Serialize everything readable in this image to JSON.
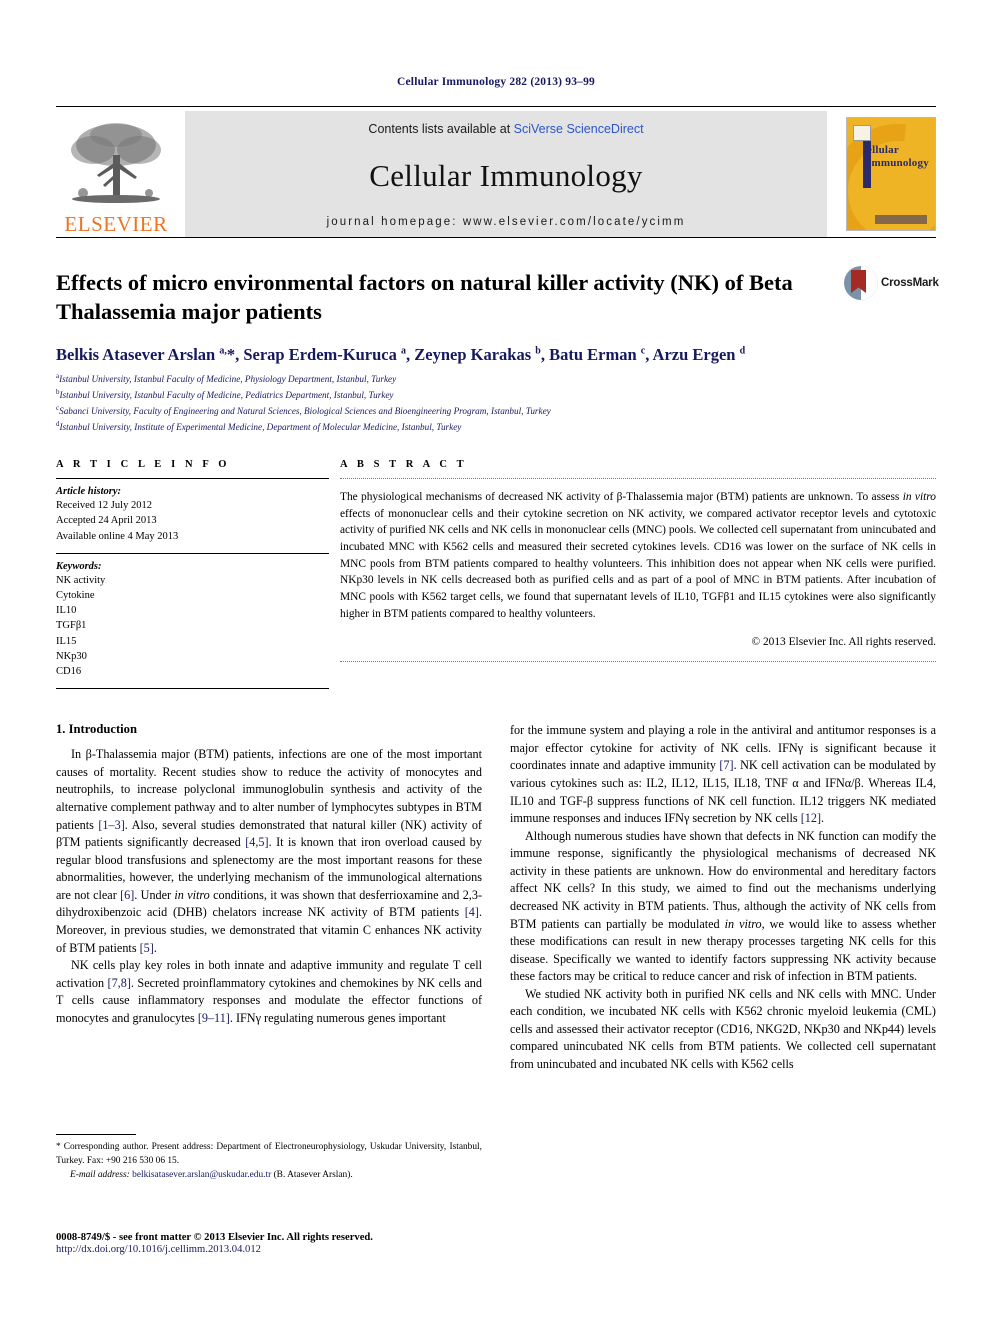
{
  "running_head": "Cellular Immunology 282 (2013) 93–99",
  "masthead": {
    "publisher_logo_text": "ELSEVIER",
    "publisher_logo_icon": "elsevier-tree-logo",
    "contents_prefix": "Contents lists available at ",
    "contents_link": "SciVerse ScienceDirect",
    "journal_title": "Cellular Immunology",
    "homepage": "journal homepage: www.elsevier.com/locate/ycimm",
    "cover": {
      "line1": "ellular",
      "line2": "Immunology",
      "accent_color": "#efb326",
      "text_color": "#2b2a6b"
    }
  },
  "article": {
    "title": "Effects of micro environmental factors on natural killer activity (NK) of Beta Thalassemia major patients",
    "crossmark_label": "CrossMark",
    "authors_html": "Belkis Atasever Arslan <sup>a,</sup>*, Serap Erdem-Kuruca <sup>a</sup>, Zeynep Karakas <sup>b</sup>, Batu Erman <sup>c</sup>, Arzu Ergen <sup>d</sup>",
    "affiliations": [
      {
        "mark": "a",
        "text": "Istanbul University, Istanbul Faculty of Medicine, Physiology Department, Istanbul, Turkey"
      },
      {
        "mark": "b",
        "text": "Istanbul University, Istanbul Faculty of Medicine, Pediatrics Department, Istanbul, Turkey"
      },
      {
        "mark": "c",
        "text": "Sabanci University, Faculty of Engineering and Natural Sciences, Biological Sciences and Bioengineering Program, Istanbul, Turkey"
      },
      {
        "mark": "d",
        "text": "Istanbul University, Institute of Experimental Medicine, Department of Molecular Medicine, Istanbul, Turkey"
      }
    ]
  },
  "article_info": {
    "heading": "A R T I C L E   I N F O",
    "history_label": "Article history:",
    "history": [
      "Received 12 July 2012",
      "Accepted 24 April 2013",
      "Available online 4 May 2013"
    ],
    "keywords_label": "Keywords:",
    "keywords": [
      "NK activity",
      "Cytokine",
      "IL10",
      "TGFβ1",
      "IL15",
      "NKp30",
      "CD16"
    ]
  },
  "abstract": {
    "heading": "A B S T R A C T",
    "text": "The physiological mechanisms of decreased NK activity of β-Thalassemia major (BTM) patients are unknown. To assess in vitro effects of mononuclear cells and their cytokine secretion on NK activity, we compared activator receptor levels and cytotoxic activity of purified NK cells and NK cells in mononuclear cells (MNC) pools. We collected cell supernatant from unincubated and incubated MNC with K562 cells and measured their secreted cytokines levels. CD16 was lower on the surface of NK cells in MNC pools from BTM patients compared to healthy volunteers. This inhibition does not appear when NK cells were purified. NKp30 levels in NK cells decreased both as purified cells and as part of a pool of MNC in BTM patients. After incubation of MNC pools with K562 target cells, we found that supernatant levels of IL10, TGFβ1 and IL15 cytokines were also significantly higher in BTM patients compared to healthy volunteers.",
    "copyright": "© 2013 Elsevier Inc. All rights reserved."
  },
  "introduction": {
    "heading": "1. Introduction",
    "left_paragraphs": [
      "In β-Thalassemia major (BTM) patients, infections are one of the most important causes of mortality. Recent studies show to reduce the activity of monocytes and neutrophils, to increase polyclonal immunoglobulin synthesis and activity of the alternative complement pathway and to alter number of lymphocytes subtypes in BTM patients [1–3]. Also, several studies demonstrated that natural killer (NK) activity of βTM patients significantly decreased [4,5]. It is known that iron overload caused by regular blood transfusions and splenectomy are the most important reasons for these abnormalities, however, the underlying mechanism of the immunological alternations are not clear [6]. Under in vitro conditions, it was shown that desferrioxamine and 2,3-dihydroxibenzoic acid (DHB) chelators increase NK activity of BTM patients [4]. Moreover, in previous studies, we demonstrated that vitamin C enhances NK activity of BTM patients [5].",
      "NK cells play key roles in both innate and adaptive immunity and regulate T cell activation [7,8]. Secreted proinflammatory cytokines and chemokines by NK cells and T cells cause inflammatory responses and modulate the effector functions of monocytes and granulocytes [9–11]. IFNγ regulating numerous genes important"
    ],
    "right_paragraphs": [
      "for the immune system and playing a role in the antiviral and antitumor responses is a major effector cytokine for activity of NK cells. IFNγ is significant because it coordinates innate and adaptive immunity [7]. NK cell activation can be modulated by various cytokines such as: IL2, IL12, IL15, IL18, TNF α and IFNα/β. Whereas IL4, IL10 and TGF-β suppress functions of NK cell function. IL12 triggers NK mediated immune responses and induces IFNγ secretion by NK cells [12].",
      "Although numerous studies have shown that defects in NK function can modify the immune response, significantly the physiological mechanisms of decreased NK activity in these patients are unknown. How do environmental and hereditary factors affect NK cells? In this study, we aimed to find out the mechanisms underlying decreased NK activity in BTM patients. Thus, although the activity of NK cells from BTM patients can partially be modulated in vitro, we would like to assess whether these modifications can result in new therapy processes targeting NK cells for this disease. Specifically we wanted to identify factors suppressing NK activity because these factors may be critical to reduce cancer and risk of infection in BTM patients.",
      "We studied NK activity both in purified NK cells and NK cells with MNC. Under each condition, we incubated NK cells with K562 chronic myeloid leukemia (CML) cells and assessed their activator receptor (CD16, NKG2D, NKp30 and NKp44) levels compared unincubated NK cells from BTM patients. We collected cell supernatant from unincubated and incubated NK cells with K562 cells"
    ]
  },
  "footnote": {
    "star": "*",
    "corresponding": "Corresponding author. Present address: Department of Electroneurophysiology, Uskudar University, Istanbul, Turkey. Fax: +90 216 530 06 15.",
    "email_label": "E-mail address:",
    "email": "belkisatasever.arslan@uskudar.edu.tr",
    "email_suffix": "(B. Atasever Arslan)."
  },
  "page_footer": {
    "line1": "0008-8749/$ - see front matter © 2013 Elsevier Inc. All rights reserved.",
    "line2": "http://dx.doi.org/10.1016/j.cellimm.2013.04.012"
  }
}
